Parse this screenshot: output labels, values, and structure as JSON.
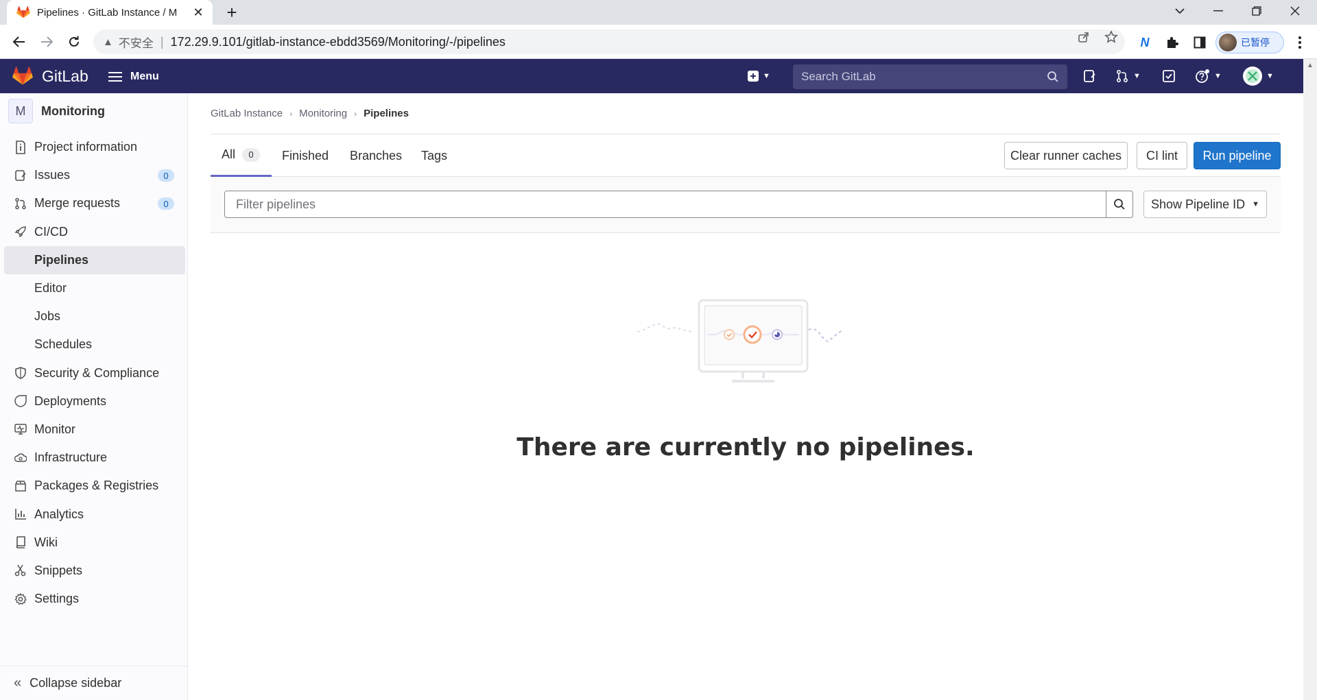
{
  "browser": {
    "tab_title": "Pipelines · GitLab Instance / M",
    "tab_close": "✕",
    "new_tab": "+",
    "insecure_label": "不安全",
    "url": "172.29.9.101/gitlab-instance-ebdd3569/Monitoring/-/pipelines",
    "profile_label": "已暂停"
  },
  "header": {
    "brand": "GitLab",
    "menu_label": "Menu",
    "search_placeholder": "Search GitLab"
  },
  "sidebar": {
    "project_initial": "M",
    "project_name": "Monitoring",
    "items": [
      {
        "label": "Project information",
        "icon": "info-icon"
      },
      {
        "label": "Issues",
        "icon": "issues-icon",
        "count": "0"
      },
      {
        "label": "Merge requests",
        "icon": "merge-request-icon",
        "count": "0"
      },
      {
        "label": "CI/CD",
        "icon": "rocket-icon"
      },
      {
        "label": "Pipelines",
        "sub": true,
        "active": true
      },
      {
        "label": "Editor",
        "sub": true
      },
      {
        "label": "Jobs",
        "sub": true
      },
      {
        "label": "Schedules",
        "sub": true
      },
      {
        "label": "Security & Compliance",
        "icon": "shield-icon"
      },
      {
        "label": "Deployments",
        "icon": "deployments-icon"
      },
      {
        "label": "Monitor",
        "icon": "monitor-icon"
      },
      {
        "label": "Infrastructure",
        "icon": "cloud-gear-icon"
      },
      {
        "label": "Packages & Registries",
        "icon": "package-icon"
      },
      {
        "label": "Analytics",
        "icon": "chart-icon"
      },
      {
        "label": "Wiki",
        "icon": "book-icon"
      },
      {
        "label": "Snippets",
        "icon": "snippet-icon"
      },
      {
        "label": "Settings",
        "icon": "settings-icon"
      }
    ],
    "collapse_label": "Collapse sidebar"
  },
  "breadcrumb": {
    "items": [
      "GitLab Instance",
      "Monitoring",
      "Pipelines"
    ]
  },
  "tabs": {
    "all": "All",
    "all_count": "0",
    "finished": "Finished",
    "branches": "Branches",
    "tags": "Tags"
  },
  "actions": {
    "clear_caches": "Clear runner caches",
    "ci_lint": "CI lint",
    "run_pipeline": "Run pipeline"
  },
  "filter": {
    "placeholder": "Filter pipelines",
    "show_id": "Show Pipeline ID"
  },
  "empty_state": {
    "message": "There are currently no pipelines."
  },
  "colors": {
    "header_bg": "#292961",
    "primary": "#1f75cb",
    "tab_active": "#6666c4",
    "badge_bg": "#cbe2f9"
  }
}
